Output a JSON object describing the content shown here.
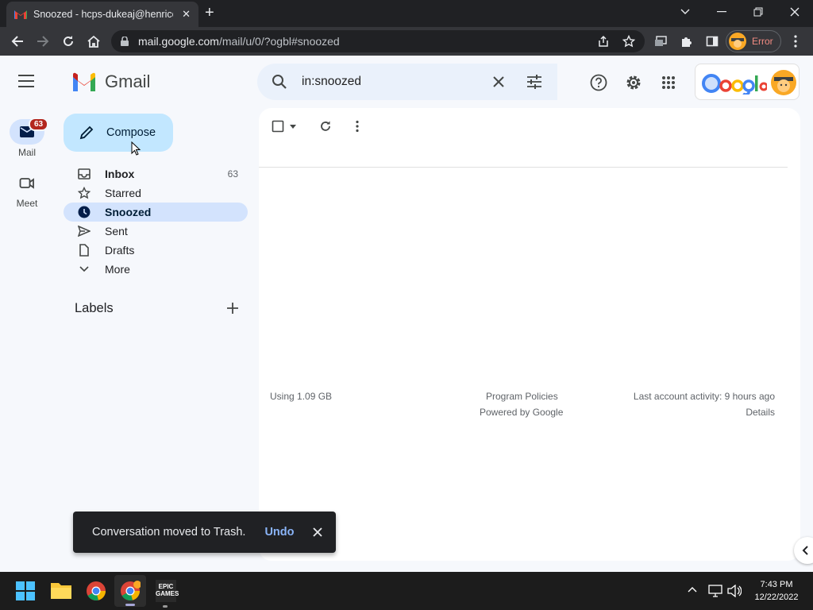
{
  "browser": {
    "tab_title": "Snoozed - hcps-dukeaj@henrico...",
    "url_host": "mail.google.com",
    "url_path": "/mail/u/0/?ogbl#snoozed",
    "profile_status": "Error"
  },
  "rail": {
    "mail_label": "Mail",
    "mail_badge": "63",
    "meet_label": "Meet"
  },
  "app": {
    "name": "Gmail"
  },
  "compose": {
    "label": "Compose"
  },
  "nav": [
    {
      "label": "Inbox",
      "count": "63",
      "icon": "inbox-icon"
    },
    {
      "label": "Starred",
      "count": "",
      "icon": "star-icon"
    },
    {
      "label": "Snoozed",
      "count": "",
      "icon": "clock-icon",
      "active": true
    },
    {
      "label": "Sent",
      "count": "",
      "icon": "send-icon"
    },
    {
      "label": "Drafts",
      "count": "",
      "icon": "draft-icon"
    },
    {
      "label": "More",
      "count": "",
      "icon": "chevron-down-icon"
    }
  ],
  "labels": {
    "heading": "Labels"
  },
  "search": {
    "query": "in:snoozed"
  },
  "footer": {
    "storage": "Using 1.09 GB",
    "policies": "Program Policies",
    "powered": "Powered by Google",
    "activity": "Last account activity: 9 hours ago",
    "details": "Details"
  },
  "snackbar": {
    "message": "Conversation moved to Trash.",
    "action": "Undo"
  },
  "taskbar": {
    "time": "7:43 PM",
    "date": "12/22/2022"
  },
  "colors": {
    "compose_bg": "#c2e7ff",
    "active_nav_bg": "#d3e3fd",
    "badge": "#b3261e",
    "error_text": "#f28b82",
    "undo_link": "#8ab4f8"
  }
}
